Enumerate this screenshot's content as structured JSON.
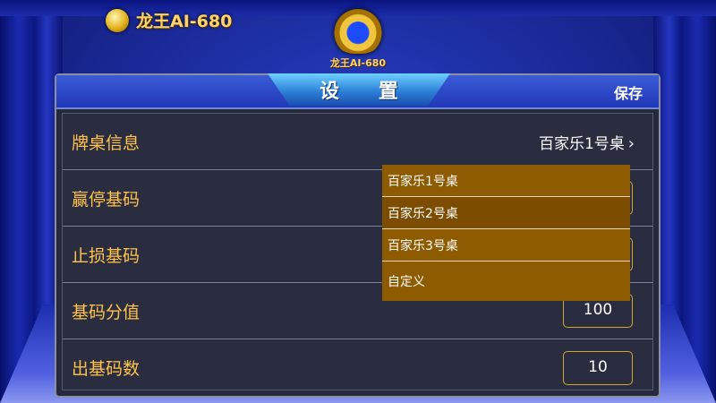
{
  "brand": {
    "name": "龙王AI-680"
  },
  "logo": {
    "caption": "龙王AI-680"
  },
  "header": {
    "title": "设 置",
    "save_label": "保存"
  },
  "rows": [
    {
      "label": "牌桌信息",
      "value": "百家乐1号桌",
      "chevron": "›"
    },
    {
      "label": "赢停基码",
      "value": ""
    },
    {
      "label": "止损基码",
      "value": ""
    },
    {
      "label": "基码分值",
      "value": "100"
    },
    {
      "label": "出基码数",
      "value": "10"
    }
  ],
  "dropdown": {
    "options": [
      "百家乐1号桌",
      "百家乐2号桌",
      "百家乐3号桌",
      "自定义"
    ]
  },
  "colors": {
    "accent": "#ffc24a",
    "dropdown_bg": "#8f5b00",
    "header_blue": "#2138b8",
    "panel_bg": "#26283c"
  }
}
